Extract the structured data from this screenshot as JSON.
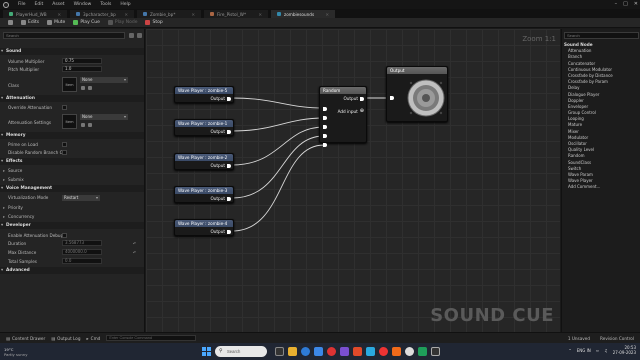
{
  "menubar": {
    "items": [
      "File",
      "Edit",
      "Asset",
      "Window",
      "Tools",
      "Help"
    ]
  },
  "tabs": [
    {
      "label": "PlayerHud_WB",
      "active": false
    },
    {
      "label": "3pcharacter_bp",
      "active": false
    },
    {
      "label": "Zombie_bp*",
      "active": false
    },
    {
      "label": "Fire_Pistol_W*",
      "active": false
    },
    {
      "label": "zombiesounds",
      "active": true
    }
  ],
  "toolbar": {
    "save": "Save",
    "edits": "Edits",
    "mute": "Mute",
    "play_cue": "Play Cue",
    "play_node": "Play Node",
    "stop": "Stop"
  },
  "details": {
    "search_placeholder": "Search",
    "categories": {
      "sound": "Sound",
      "attenuation": "Attenuation",
      "memory": "Memory",
      "effects": "Effects",
      "voice_management": "Voice Management",
      "developer": "Developer",
      "advanced": "Advanced"
    },
    "props": {
      "volume_multiplier": "Volume Multiplier",
      "volume_value": "0.75",
      "pitch_multiplier": "Pitch Multiplier",
      "pitch_value": "1.0",
      "class": "Class",
      "class_value": "None",
      "override_attenuation": "Override Attenuation",
      "attenuation_settings": "Attenuation Settings",
      "attenuation_value": "None",
      "prime_on_load": "Prime on Load",
      "disable_random": "Disable Random Branch C...",
      "source": "Source",
      "submix": "Submix",
      "virtualization_mode": "Virtualization Mode",
      "virtualization_value": "Restart",
      "priority": "Priority",
      "concurrency": "Concurrency",
      "enable_attenuation_debug": "Enable Attenuation Debug",
      "duration": "Duration",
      "duration_value": "3.568773",
      "max_distance": "Max Distance",
      "max_distance_value": "4000000.0",
      "total_samples": "Total Samples",
      "total_samples_value": "0.0",
      "thumb_label": "Item"
    }
  },
  "graph": {
    "zoom": "Zoom 1:1",
    "watermark": "SOUND CUE",
    "wave_nodes": [
      {
        "title": "Wave Player : zombie-5",
        "out": "Output"
      },
      {
        "title": "Wave Player : zombie-1",
        "out": "Output"
      },
      {
        "title": "Wave Player : zombie-2",
        "out": "Output"
      },
      {
        "title": "Wave Player : zombie-3",
        "out": "Output"
      },
      {
        "title": "Wave Player : zombie-4",
        "out": "Output"
      }
    ],
    "random_node": {
      "title": "Random",
      "out": "Output",
      "add_input": "Add input"
    },
    "output_node": {
      "title": "Output"
    }
  },
  "palette": {
    "search_placeholder": "Search",
    "header": "Sound Node",
    "items": [
      "Attenuation",
      "Branch",
      "Concatenator",
      "Continuous Modulator",
      "Crossfade by Distance",
      "Crossfade by Param",
      "Delay",
      "Dialogue Player",
      "Doppler",
      "Enveloper",
      "Group Control",
      "Looping",
      "Mature",
      "Mixer",
      "Modulator",
      "Oscillator",
      "Quality Level",
      "Random",
      "SoundClass",
      "Switch",
      "Wave Param",
      "Wave Player",
      "Add Comment..."
    ]
  },
  "statusbar": {
    "content_drawer": "Content Drawer",
    "output_log": "Output Log",
    "cmd": "Cmd",
    "cmd_placeholder": "Enter Console Command",
    "unsaved": "1 Unsaved",
    "revision": "Revision Control"
  },
  "taskbar": {
    "temp": "19°C",
    "weather": "Partly sunny",
    "search_placeholder": "Search",
    "time": "20:53",
    "date": "27-09-2023",
    "lang": "ENG IN"
  },
  "colors": {
    "node_header": "#4a5a78",
    "graph_bg": "#262626",
    "accent": "#4aa8ff"
  }
}
